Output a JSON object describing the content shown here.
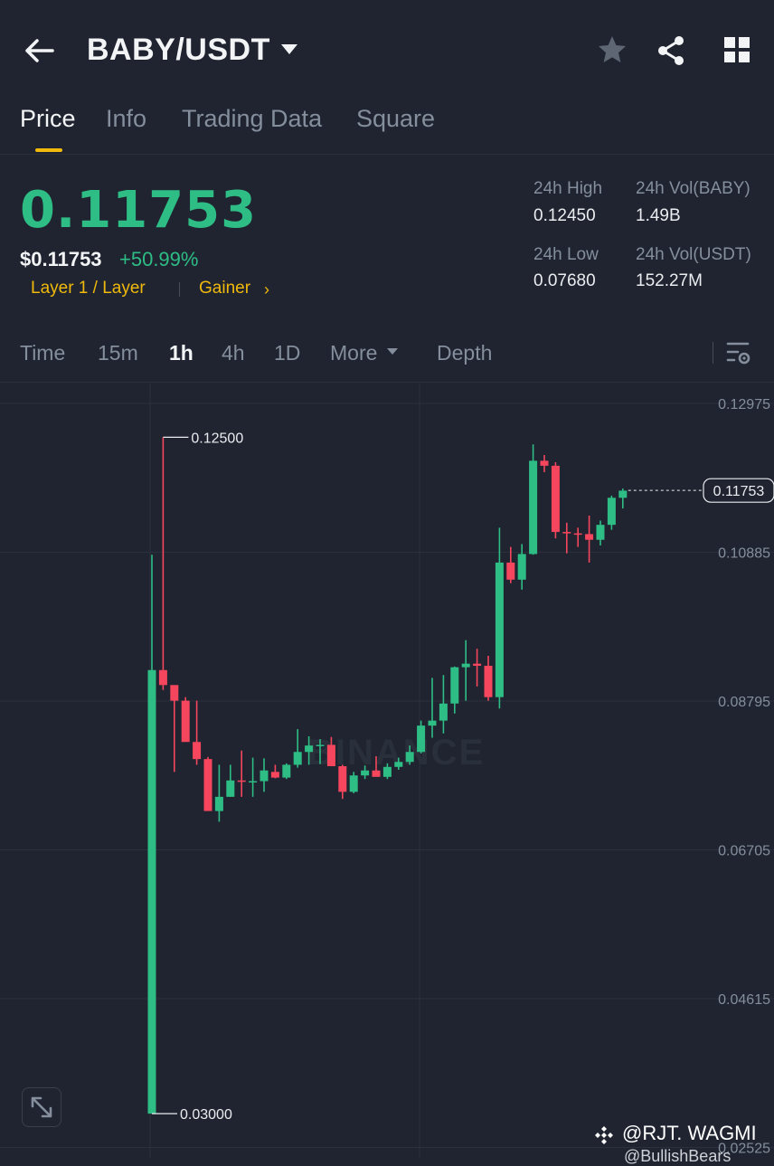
{
  "header": {
    "pair": "BABY/USDT"
  },
  "tabs": [
    {
      "label": "Price",
      "active": true
    },
    {
      "label": "Info",
      "active": false
    },
    {
      "label": "Trading Data",
      "active": false
    },
    {
      "label": "Square",
      "active": false
    }
  ],
  "ticker": {
    "last_price": "0.11753",
    "usd_price": "$0.11753",
    "change_pct": "+50.99%",
    "tag_category": "Layer 1 / Layer",
    "tag_gainer": "Gainer",
    "high_label": "24h High",
    "high_value": "0.12450",
    "low_label": "24h Low",
    "low_value": "0.07680",
    "vol_base_label": "24h Vol(BABY)",
    "vol_base_value": "1.49B",
    "vol_quote_label": "24h Vol(USDT)",
    "vol_quote_value": "152.27M"
  },
  "timeframes": {
    "time": "Time",
    "m15": "15m",
    "h1": "1h",
    "h4": "4h",
    "d1": "1D",
    "more": "More",
    "depth": "Depth",
    "active": "1h"
  },
  "colors": {
    "up": "#2ebd85",
    "down": "#f6465d",
    "accent": "#f0b90b",
    "background": "#1f2430"
  },
  "watermark": "BINANCE",
  "credit": "@RJT. WAGMI",
  "credit2": "@BullishBears",
  "chart_data": {
    "type": "candlestick",
    "y_ticks": [
      "0.12975",
      "0.10885",
      "0.08795",
      "0.06705",
      "0.04615",
      "0.02525"
    ],
    "last_price_label": "0.11753",
    "last_price": 0.11753,
    "max_label": "0.12500",
    "max_value": 0.125,
    "min_label": "0.03000",
    "min_value": 0.03,
    "ylim": [
      0.02525,
      0.1345
    ],
    "candles": [
      {
        "o": 0.03,
        "h": 0.1085,
        "l": 0.03,
        "c": 0.0923
      },
      {
        "o": 0.0923,
        "h": 0.125,
        "l": 0.0895,
        "c": 0.0902
      },
      {
        "o": 0.0902,
        "h": 0.09,
        "l": 0.078,
        "c": 0.088
      },
      {
        "o": 0.088,
        "h": 0.0885,
        "l": 0.084,
        "c": 0.0822
      },
      {
        "o": 0.0822,
        "h": 0.088,
        "l": 0.079,
        "c": 0.0798
      },
      {
        "o": 0.0798,
        "h": 0.0801,
        "l": 0.0765,
        "c": 0.0725
      },
      {
        "o": 0.0725,
        "h": 0.079,
        "l": 0.071,
        "c": 0.0745
      },
      {
        "o": 0.0745,
        "h": 0.079,
        "l": 0.0745,
        "c": 0.0768
      },
      {
        "o": 0.0768,
        "h": 0.081,
        "l": 0.0745,
        "c": 0.0766
      },
      {
        "o": 0.0766,
        "h": 0.08,
        "l": 0.0745,
        "c": 0.0767
      },
      {
        "o": 0.0767,
        "h": 0.0799,
        "l": 0.0752,
        "c": 0.0782
      },
      {
        "o": 0.078,
        "h": 0.079,
        "l": 0.0771,
        "c": 0.0772
      },
      {
        "o": 0.0772,
        "h": 0.0792,
        "l": 0.077,
        "c": 0.079
      },
      {
        "o": 0.079,
        "h": 0.084,
        "l": 0.0786,
        "c": 0.0808
      },
      {
        "o": 0.0808,
        "h": 0.083,
        "l": 0.079,
        "c": 0.0817
      },
      {
        "o": 0.0817,
        "h": 0.0826,
        "l": 0.0791,
        "c": 0.0818
      },
      {
        "o": 0.0818,
        "h": 0.0829,
        "l": 0.0795,
        "c": 0.0788
      },
      {
        "o": 0.0788,
        "h": 0.079,
        "l": 0.0742,
        "c": 0.0752
      },
      {
        "o": 0.0752,
        "h": 0.078,
        "l": 0.075,
        "c": 0.0775
      },
      {
        "o": 0.0775,
        "h": 0.0789,
        "l": 0.077,
        "c": 0.0782
      },
      {
        "o": 0.0782,
        "h": 0.0802,
        "l": 0.0774,
        "c": 0.0773
      },
      {
        "o": 0.0773,
        "h": 0.0792,
        "l": 0.077,
        "c": 0.0787
      },
      {
        "o": 0.0787,
        "h": 0.08,
        "l": 0.0783,
        "c": 0.0794
      },
      {
        "o": 0.0794,
        "h": 0.0817,
        "l": 0.079,
        "c": 0.0808
      },
      {
        "o": 0.0808,
        "h": 0.0852,
        "l": 0.0806,
        "c": 0.0845
      },
      {
        "o": 0.0845,
        "h": 0.0912,
        "l": 0.0828,
        "c": 0.0852
      },
      {
        "o": 0.0852,
        "h": 0.0916,
        "l": 0.0834,
        "c": 0.0876
      },
      {
        "o": 0.0876,
        "h": 0.0928,
        "l": 0.0862,
        "c": 0.0927
      },
      {
        "o": 0.0927,
        "h": 0.0965,
        "l": 0.088,
        "c": 0.0932
      },
      {
        "o": 0.0932,
        "h": 0.0953,
        "l": 0.09,
        "c": 0.0929
      },
      {
        "o": 0.0929,
        "h": 0.0943,
        "l": 0.088,
        "c": 0.0885
      },
      {
        "o": 0.0885,
        "h": 0.1123,
        "l": 0.0869,
        "c": 0.1074
      },
      {
        "o": 0.1074,
        "h": 0.1096,
        "l": 0.1045,
        "c": 0.105
      },
      {
        "o": 0.105,
        "h": 0.11,
        "l": 0.1036,
        "c": 0.1086
      },
      {
        "o": 0.1086,
        "h": 0.124,
        "l": 0.1085,
        "c": 0.1217
      },
      {
        "o": 0.1217,
        "h": 0.1225,
        "l": 0.1201,
        "c": 0.121
      },
      {
        "o": 0.121,
        "h": 0.1215,
        "l": 0.1108,
        "c": 0.1117
      },
      {
        "o": 0.1117,
        "h": 0.113,
        "l": 0.1087,
        "c": 0.1115
      },
      {
        "o": 0.1115,
        "h": 0.1123,
        "l": 0.1096,
        "c": 0.1114
      },
      {
        "o": 0.1114,
        "h": 0.114,
        "l": 0.1074,
        "c": 0.1106
      },
      {
        "o": 0.1106,
        "h": 0.1133,
        "l": 0.1098,
        "c": 0.1127
      },
      {
        "o": 0.1127,
        "h": 0.1168,
        "l": 0.112,
        "c": 0.1165
      },
      {
        "o": 0.1165,
        "h": 0.1178,
        "l": 0.115,
        "c": 0.1175
      }
    ]
  }
}
